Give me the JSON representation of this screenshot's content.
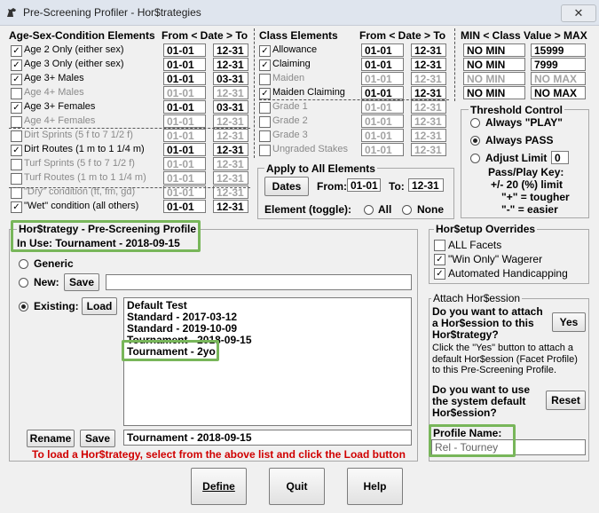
{
  "window": {
    "title": "Pre-Screening Profiler - Hor$trategies",
    "close_glyph": "✕"
  },
  "age_sex": {
    "header": "Age-Sex-Condition Elements",
    "date_header": "From < Date > To",
    "rows": [
      {
        "label": "Age 2 Only (either sex)",
        "checked": true,
        "from": "01-01",
        "to": "12-31",
        "enabled": true
      },
      {
        "label": "Age 3 Only (either sex)",
        "checked": true,
        "from": "01-01",
        "to": "12-31",
        "enabled": true
      },
      {
        "label": "Age 3+ Males",
        "checked": true,
        "from": "01-01",
        "to": "03-31",
        "enabled": true
      },
      {
        "label": "Age 4+ Males",
        "checked": false,
        "from": "01-01",
        "to": "12-31",
        "enabled": false
      },
      {
        "label": "Age 3+ Females",
        "checked": true,
        "from": "01-01",
        "to": "03-31",
        "enabled": true
      },
      {
        "label": "Age 4+ Females",
        "checked": false,
        "from": "01-01",
        "to": "12-31",
        "enabled": false
      },
      {
        "label": "Dirt Sprints (5 f to 7 1/2 f)",
        "checked": false,
        "from": "01-01",
        "to": "12-31",
        "enabled": false
      },
      {
        "label": "Dirt Routes (1 m to 1 1/4 m)",
        "checked": true,
        "from": "01-01",
        "to": "12-31",
        "enabled": true
      },
      {
        "label": "Turf Sprints (5 f to 7 1/2 f)",
        "checked": false,
        "from": "01-01",
        "to": "12-31",
        "enabled": false
      },
      {
        "label": "Turf Routes (1 m to 1 1/4 m)",
        "checked": false,
        "from": "01-01",
        "to": "12-31",
        "enabled": false
      },
      {
        "label": "\"Dry\" condition (ft, fm, gd)",
        "checked": false,
        "from": "01-01",
        "to": "12-31",
        "enabled": false
      },
      {
        "label": "\"Wet\" condition (all others)",
        "checked": true,
        "from": "01-01",
        "to": "12-31",
        "enabled": true
      }
    ]
  },
  "class": {
    "header": "Class Elements",
    "date_header": "From < Date > To",
    "value_header": "MIN < Class Value > MAX",
    "rows": [
      {
        "label": "Allowance",
        "checked": true,
        "from": "01-01",
        "to": "12-31",
        "enabled": true,
        "min": "NO MIN",
        "max": "15999",
        "min_enabled": true,
        "max_enabled": true
      },
      {
        "label": "Claiming",
        "checked": true,
        "from": "01-01",
        "to": "12-31",
        "enabled": true,
        "min": "NO MIN",
        "max": "7999",
        "min_enabled": true,
        "max_enabled": true
      },
      {
        "label": "Maiden",
        "checked": false,
        "from": "01-01",
        "to": "12-31",
        "enabled": false,
        "min": "NO MIN",
        "max": "NO MAX",
        "min_enabled": false,
        "max_enabled": false
      },
      {
        "label": "Maiden Claiming",
        "checked": true,
        "from": "01-01",
        "to": "12-31",
        "enabled": true,
        "min": "NO MIN",
        "max": "NO MAX",
        "min_enabled": true,
        "max_enabled": true
      },
      {
        "label": "Grade 1",
        "checked": false,
        "from": "01-01",
        "to": "12-31",
        "enabled": false
      },
      {
        "label": "Grade 2",
        "checked": false,
        "from": "01-01",
        "to": "12-31",
        "enabled": false
      },
      {
        "label": "Grade 3",
        "checked": false,
        "from": "01-01",
        "to": "12-31",
        "enabled": false
      },
      {
        "label": "Ungraded Stakes",
        "checked": false,
        "from": "01-01",
        "to": "12-31",
        "enabled": false
      }
    ]
  },
  "threshold": {
    "title": "Threshold Control",
    "options": [
      {
        "label": "Always \"PLAY\"",
        "selected": false
      },
      {
        "label": "Always PASS",
        "selected": true
      },
      {
        "label": "Adjust Limit",
        "selected": false
      }
    ],
    "limit_value": "0",
    "key_title": "Pass/Play Key:",
    "key_line1": "+/- 20 (%) limit",
    "key_line2": "\"+\" = tougher",
    "key_line3": "\"-\" = easier"
  },
  "apply_all": {
    "title": "Apply to All Elements",
    "dates_button": "Dates",
    "from_label": "From:",
    "from_value": "01-01",
    "to_label": "To:",
    "to_value": "12-31",
    "toggle_label": "Element (toggle):",
    "all_label": "All",
    "none_label": "None"
  },
  "profile": {
    "title": "Hor$trategy - Pre-Screening Profile",
    "in_use": "In Use: Tournament - 2018-09-15",
    "generic_label": "Generic",
    "new_label": "New:",
    "save_label": "Save",
    "new_value": "",
    "existing_label": "Existing:",
    "load_label": "Load",
    "list_items": [
      "Default Test",
      "Standard - 2017-03-12",
      "Standard - 2019-10-09",
      "Tournament - 2018-09-15",
      "Tournament - 2yo"
    ],
    "rename_label": "Rename",
    "save2_label": "Save",
    "current_name": "Tournament - 2018-09-15",
    "instruction": "To load a Hor$trategy, select from the above list and click the Load button"
  },
  "overrides": {
    "title": "Hor$etup Overrides",
    "items": [
      {
        "label": "ALL Facets",
        "checked": false
      },
      {
        "label": "\"Win Only\" Wagerer",
        "checked": true
      },
      {
        "label": "Automated Handicapping",
        "checked": true
      }
    ]
  },
  "attach": {
    "title": "Attach Hor$ession",
    "question": "Do you want to attach a Hor$ession to this Hor$trategy?",
    "yes_label": "Yes",
    "desc": "Click the \"Yes\" button to attach a default Hor$ession (Facet Profile) to this Pre-Screening Profile.",
    "question2": "Do you want to use the system default Hor$ession?",
    "reset_label": "Reset",
    "profile_name_label": "Profile Name:",
    "profile_name_value": "Rel - Tourney"
  },
  "bottom": {
    "define_label": "Define",
    "quit_label": "Quit",
    "help_label": "Help"
  },
  "colors": {
    "accent_green": "#78b65a",
    "instruction_red": "#d00000"
  }
}
